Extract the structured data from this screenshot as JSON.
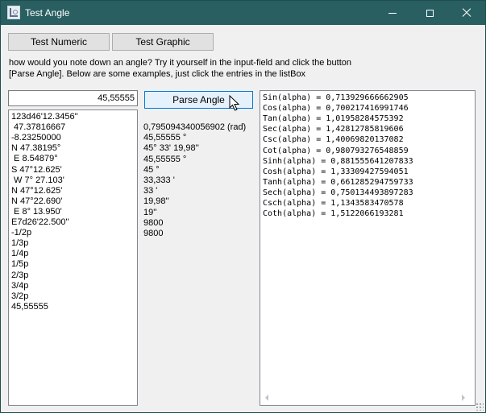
{
  "window": {
    "title": "Test Angle"
  },
  "tabs": {
    "numeric_label": "Test Numeric",
    "graphic_label": "Test Graphic"
  },
  "description": "how would you note down an angle? Try it yourself in the input-field and click the button\n[Parse Angle]. Below are some examples, just click the entries in the listBox",
  "input": {
    "value": "45,55555"
  },
  "parse_button": {
    "label": "Parse Angle"
  },
  "examples": [
    "123d46'12.3456''",
    " 47.37816667",
    "-8.23250000",
    "N 47.38195°",
    " E 8.54879°",
    "S 47°12.625'",
    " W 7° 27.103'",
    "N 47°12.625'",
    "N 47°22.690'",
    " E 8° 13.950'",
    "E7d26'22.500''",
    "-1/2p",
    "1/3p",
    "1/4p",
    "1/5p",
    "2/3p",
    "3/4p",
    "3/2p",
    "45,55555"
  ],
  "results": [
    "0,795094340056902 (rad)",
    "45,55555 °",
    "45° 33' 19,98''",
    "45,55555 °",
    "45 °",
    "33,333 '",
    "33 '",
    "19,98''",
    "19''",
    "9800",
    "9800"
  ],
  "functions": [
    "Sin(alpha) = 0,713929666662905",
    "Cos(alpha) = 0,700217416991746",
    "Tan(alpha) = 1,01958284575392",
    "Sec(alpha) = 1,42812785819606",
    "Csc(alpha) = 1,40069820137082",
    "Cot(alpha) = 0,980793276548859",
    "Sinh(alpha) = 0,881555641207833",
    "Cosh(alpha) = 1,33309427594051",
    "Tanh(alpha) = 0,661285294759733",
    "Sech(alpha) = 0,750134493897283",
    "Csch(alpha) = 1,1343583470578",
    "Coth(alpha) = 1,5122066193281"
  ]
}
